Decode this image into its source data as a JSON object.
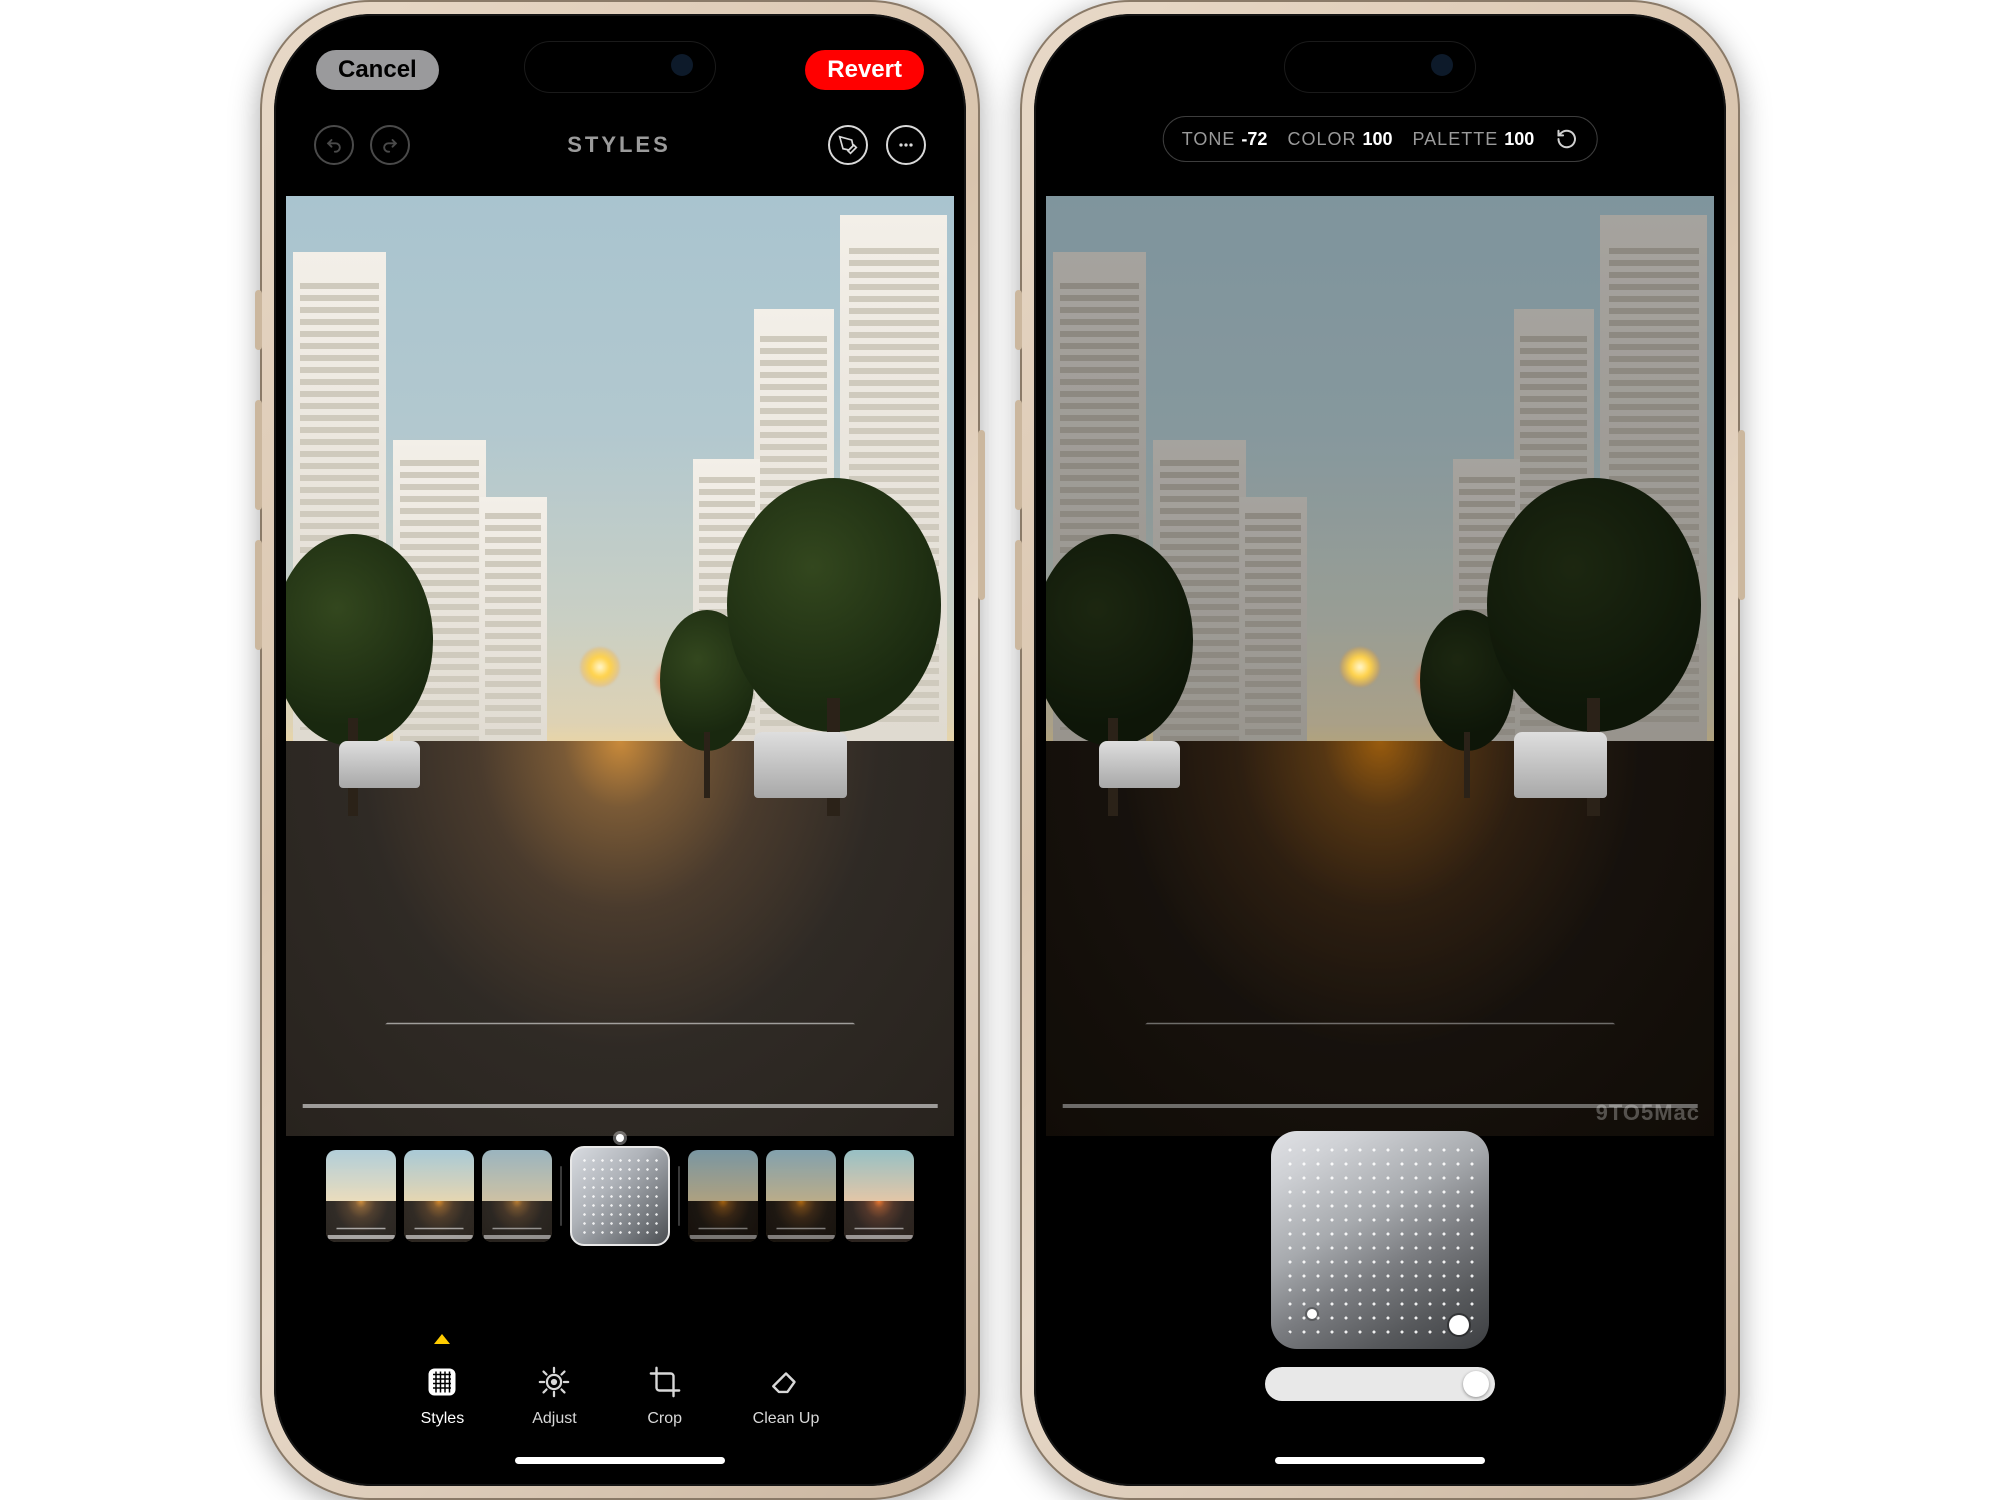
{
  "left": {
    "nav": {
      "cancel": "Cancel",
      "revert": "Revert"
    },
    "title": "STYLES",
    "tabs": {
      "styles": "Styles",
      "adjust": "Adjust",
      "crop": "Crop",
      "cleanup": "Clean Up"
    }
  },
  "right": {
    "params": {
      "tone": {
        "label": "TONE",
        "value": "-72"
      },
      "color": {
        "label": "COLOR",
        "value": "100"
      },
      "palette": {
        "label": "PALETTE",
        "value": "100"
      }
    },
    "watermark": "9TO5Mac"
  }
}
